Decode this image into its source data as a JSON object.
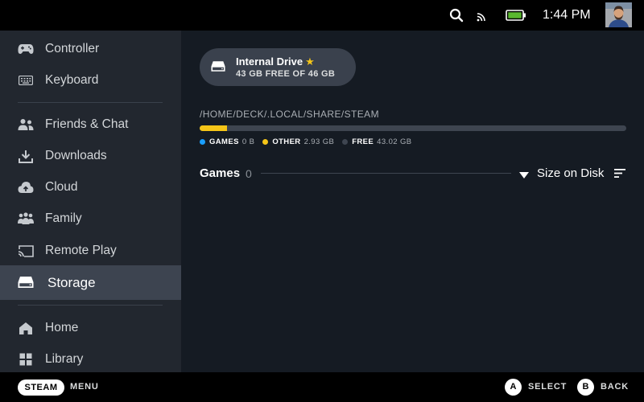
{
  "status_bar": {
    "time": "1:44 PM",
    "icons": [
      "search-icon",
      "cast-icon",
      "battery-icon"
    ]
  },
  "sidebar": {
    "groups": [
      [
        {
          "label": "Controller",
          "icon": "controller-icon"
        },
        {
          "label": "Keyboard",
          "icon": "keyboard-icon"
        }
      ],
      [
        {
          "label": "Friends & Chat",
          "icon": "friends-icon"
        },
        {
          "label": "Downloads",
          "icon": "download-icon"
        },
        {
          "label": "Cloud",
          "icon": "cloud-icon"
        },
        {
          "label": "Family",
          "icon": "family-icon"
        },
        {
          "label": "Remote Play",
          "icon": "remote-play-icon"
        },
        {
          "label": "Storage",
          "icon": "storage-icon",
          "active": true
        }
      ],
      [
        {
          "label": "Home",
          "icon": "home-icon"
        },
        {
          "label": "Library",
          "icon": "library-icon"
        }
      ]
    ]
  },
  "storage": {
    "drive": {
      "name": "Internal Drive",
      "free_text": "43 GB FREE OF 46 GB"
    },
    "path": "/HOME/DECK/.LOCAL/SHARE/STEAM",
    "usage_fractions": {
      "games": 0.0,
      "other": 0.0637,
      "free": 0.9363
    },
    "legend": [
      {
        "label": "GAMES",
        "value": "0 B",
        "color": "#1a9fff"
      },
      {
        "label": "OTHER",
        "value": "2.93 GB",
        "color": "#f5c518"
      },
      {
        "label": "FREE",
        "value": "43.02 GB",
        "color": "#3e4550"
      }
    ],
    "games_header": "Games",
    "games_count": "0",
    "sort_label": "Size on Disk"
  },
  "bottom_bar": {
    "steam_label": "STEAM",
    "menu_label": "MENU",
    "select_button": "A",
    "select_label": "SELECT",
    "back_button": "B",
    "back_label": "BACK"
  },
  "colors": {
    "accent_yellow": "#f5c518",
    "games_blue": "#1a9fff",
    "sidebar_bg": "#22272f",
    "main_bg": "#151b23",
    "active_bg": "#3d4450"
  }
}
